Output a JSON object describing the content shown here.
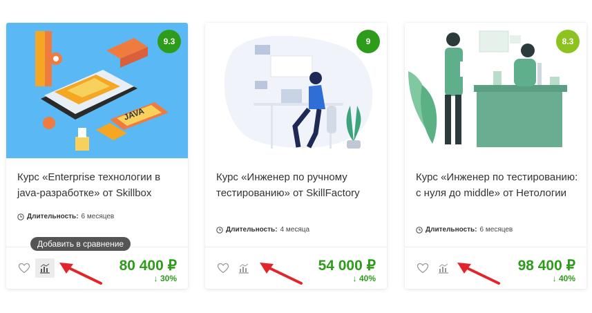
{
  "cards": [
    {
      "rating": "9.3",
      "rating_color": "#2e9c1b",
      "title": "Курс «Enterprise технологии в java-разработке» от Skillbox",
      "duration_label": "Длительность:",
      "duration_value": "6 месяцев",
      "price": "80 400 ₽",
      "discount": "↓ 30%"
    },
    {
      "rating": "9",
      "rating_color": "#2e9c1b",
      "title": "Курс «Инженер по ручному тестированию» от SkillFactory",
      "duration_label": "Длительность:",
      "duration_value": "4 месяца",
      "price": "54 000 ₽",
      "discount": "↓ 40%"
    },
    {
      "rating": "8.3",
      "rating_color": "#8dc21f",
      "title": "Курс «Инженер по тестированию: с нуля до middle» от Нетологии",
      "duration_label": "Длительность:",
      "duration_value": "6 месяцев",
      "price": "98 400 ₽",
      "discount": "↓ 40%"
    }
  ],
  "tooltip": "Добавить в сравнение",
  "colors": {
    "price": "#2e9c1b",
    "arrow": "#e3242b",
    "cover_1_bg": "#5ab8f5"
  },
  "icons": [
    "heart-icon",
    "compare-chart-icon",
    "clock-icon",
    "arrow-annotation-icon"
  ]
}
